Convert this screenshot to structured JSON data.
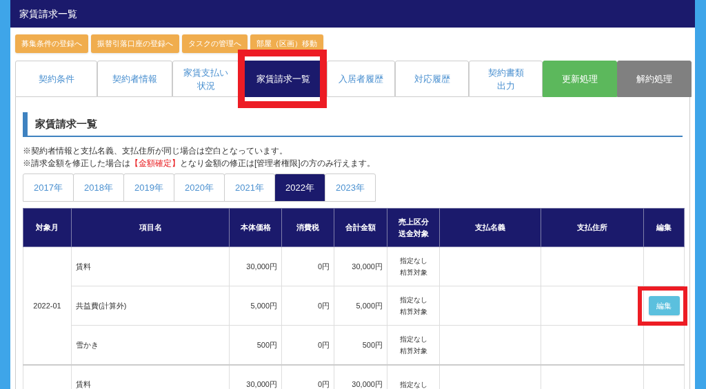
{
  "header": {
    "title": "家賃請求一覧"
  },
  "action_buttons": [
    "募集条件の登録へ",
    "振替引落口座の登録へ",
    "タスクの管理へ",
    "部屋（区画）移動"
  ],
  "tabs": [
    {
      "label": "契約条件",
      "kind": "normal",
      "selected": false,
      "highlighted": false
    },
    {
      "label": "契約者情報",
      "kind": "normal",
      "selected": false,
      "highlighted": false
    },
    {
      "label": [
        "家賃支払い",
        "状況"
      ],
      "kind": "normal",
      "selected": false,
      "highlighted": false
    },
    {
      "label": "家賃請求一覧",
      "kind": "normal",
      "selected": true,
      "highlighted": true
    },
    {
      "label": "入居者履歴",
      "kind": "normal",
      "selected": false,
      "highlighted": false
    },
    {
      "label": "対応履歴",
      "kind": "normal",
      "selected": false,
      "highlighted": false
    },
    {
      "label": [
        "契約書類",
        "出力"
      ],
      "kind": "normal",
      "selected": false,
      "highlighted": false
    },
    {
      "label": "更新処理",
      "kind": "renew",
      "selected": false,
      "highlighted": false
    },
    {
      "label": "解約処理",
      "kind": "cancel",
      "selected": false,
      "highlighted": false
    }
  ],
  "section_title": "家賃請求一覧",
  "notes": [
    "※契約者情報と支払名義、支払住所が同じ場合は空白となっています。",
    [
      {
        "text": "※請求金額を修正した場合は",
        "kind": "plain"
      },
      {
        "text": "【金額確定】",
        "kind": "alert"
      },
      {
        "text": "となり金額の修正は[管理者権限]の方のみ行えます。",
        "kind": "plain"
      }
    ]
  ],
  "year_tabs": [
    {
      "label": "2017年",
      "selected": false
    },
    {
      "label": "2018年",
      "selected": false
    },
    {
      "label": "2019年",
      "selected": false
    },
    {
      "label": "2020年",
      "selected": false
    },
    {
      "label": "2021年",
      "selected": false
    },
    {
      "label": "2022年",
      "selected": true
    },
    {
      "label": "2023年",
      "selected": false
    }
  ],
  "table": {
    "columns": [
      "対象月",
      "項目名",
      "本体価格",
      "消費税",
      "合計金額",
      [
        "売上区分",
        "送金対象"
      ],
      "支払名義",
      "支払住所",
      "編集"
    ],
    "groups": [
      {
        "month": "2022-01",
        "rows": [
          {
            "item": "賃料",
            "price": "30,000円",
            "tax": "0円",
            "total": "30,000円",
            "category": [
              "指定なし",
              "精算対象"
            ]
          },
          {
            "item": "共益費(計算外)",
            "price": "5,000円",
            "tax": "0円",
            "total": "5,000円",
            "category": [
              "指定なし",
              "精算対象"
            ],
            "edit_button": {
              "label": "編集",
              "highlighted": true
            }
          },
          {
            "item": "雪かき",
            "price": "500円",
            "tax": "0円",
            "total": "500円",
            "category": [
              "指定なし",
              "精算対象"
            ]
          }
        ]
      },
      {
        "rows": [
          {
            "item": "賃料",
            "price": "30,000円",
            "tax": "0円",
            "total": "30,000円",
            "category": [
              "指定なし"
            ]
          }
        ]
      }
    ]
  }
}
